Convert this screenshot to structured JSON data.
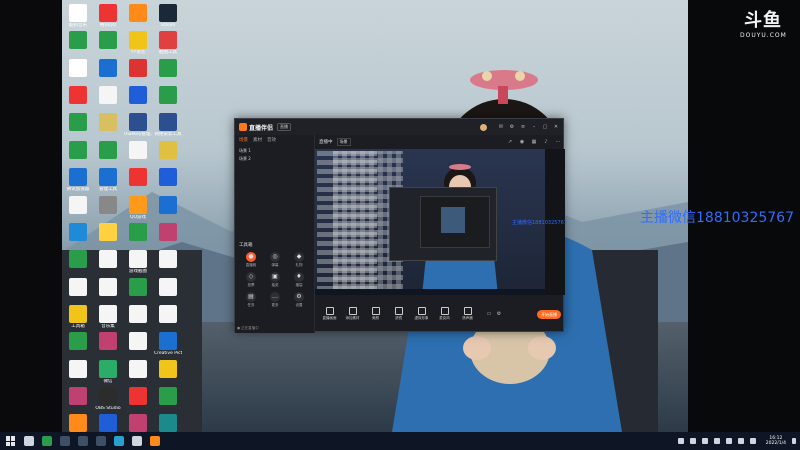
{
  "watermark": {
    "contact": "主播微信18810325767",
    "small_text": "主播微信18810325767"
  },
  "brand": {
    "logo_big": "斗鱼",
    "logo_small": "DOUYU.COM"
  },
  "desktop_icons": [
    {
      "label": "酷狗音乐",
      "color": "#ffffff"
    },
    {
      "label": "腾讯QQ",
      "color": "#e33"
    },
    {
      "label": "",
      "color": "#ff8a1a"
    },
    {
      "label": "Steam",
      "color": "#1b2838"
    },
    {
      "label": "",
      "color": "#2a9d4a"
    },
    {
      "label": "",
      "color": "#2a9d4a"
    },
    {
      "label": "YY语音",
      "color": "#f0c419"
    },
    {
      "label": "截图工具",
      "color": "#e04040"
    },
    {
      "label": "",
      "color": "#fff"
    },
    {
      "label": "",
      "color": "#1a6fd1"
    },
    {
      "label": "",
      "color": "#d33"
    },
    {
      "label": "",
      "color": "#2a9d4a"
    },
    {
      "label": "",
      "color": "#e33"
    },
    {
      "label": "",
      "color": "#f5f5f5"
    },
    {
      "label": "",
      "color": "#1f5ed8"
    },
    {
      "label": "",
      "color": "#2a9d4a"
    },
    {
      "label": "",
      "color": "#2a9d4a"
    },
    {
      "label": "",
      "color": "#d8c060"
    },
    {
      "label": "USBKey管理工具",
      "color": "#2b4f8f"
    },
    {
      "label": "网络安装工具",
      "color": "#2b4f8f"
    },
    {
      "label": "",
      "color": "#2a9d4a"
    },
    {
      "label": "",
      "color": "#2a9d4a"
    },
    {
      "label": "",
      "color": "#f5f5f5"
    },
    {
      "label": "",
      "color": "#e0c040"
    },
    {
      "label": "腾讯加速器",
      "color": "#1a6fd1"
    },
    {
      "label": "管理工具",
      "color": "#1a6fd1"
    },
    {
      "label": "",
      "color": "#e33"
    },
    {
      "label": "",
      "color": "#1f5ed8"
    },
    {
      "label": "",
      "color": "#f5f5f5"
    },
    {
      "label": "",
      "color": "#888"
    },
    {
      "label": "QQ游戏",
      "color": "#ff9a1a"
    },
    {
      "label": "",
      "color": "#1a6fd1"
    },
    {
      "label": "",
      "color": "#1f8ad8"
    },
    {
      "label": "",
      "color": "#ffd040"
    },
    {
      "label": "",
      "color": "#2a9d4a"
    },
    {
      "label": "",
      "color": "#c04070"
    },
    {
      "label": "",
      "color": "#2a9d4a"
    },
    {
      "label": "",
      "color": "#f5f5f5"
    },
    {
      "label": "游戏截图",
      "color": "#f5f5f5"
    },
    {
      "label": "",
      "color": "#f5f5f5"
    },
    {
      "label": "",
      "color": "#f5f5f5"
    },
    {
      "label": "",
      "color": "#f5f5f5"
    },
    {
      "label": "",
      "color": "#2a9d4a"
    },
    {
      "label": "",
      "color": "#f5f5f5"
    },
    {
      "label": "工具箱",
      "color": "#f0c419"
    },
    {
      "label": "音乐集",
      "color": "#f5f5f5"
    },
    {
      "label": "",
      "color": "#f5f5f5"
    },
    {
      "label": "",
      "color": "#f5f5f5"
    },
    {
      "label": "",
      "color": "#2a9d4a"
    },
    {
      "label": "",
      "color": "#c04070"
    },
    {
      "label": "",
      "color": "#f5f5f5"
    },
    {
      "label": "Creative Pictures",
      "color": "#1a6fd1"
    },
    {
      "label": "",
      "color": "#f5f5f5"
    },
    {
      "label": "微信",
      "color": "#2aae67"
    },
    {
      "label": "",
      "color": "#f5f5f5"
    },
    {
      "label": "",
      "color": "#f0c419"
    },
    {
      "label": "",
      "color": "#c04070"
    },
    {
      "label": "OBS Studio",
      "color": "#2c2c2c"
    },
    {
      "label": "",
      "color": "#e33"
    },
    {
      "label": "",
      "color": "#2a9d4a"
    },
    {
      "label": "",
      "color": "#ff8a1a"
    },
    {
      "label": "",
      "color": "#1f5ed8"
    },
    {
      "label": "",
      "color": "#c04070"
    },
    {
      "label": "",
      "color": "#1a8a8a"
    }
  ],
  "app": {
    "name": "直播伴侣",
    "version": "直播",
    "preview_title": "直播中",
    "preview_badge": "场景",
    "scene_tabs": [
      {
        "label": "场景",
        "active": true
      },
      {
        "label": "素材",
        "active": false
      },
      {
        "label": "音效",
        "active": false
      }
    ],
    "scene_rows": [
      "场景 1",
      "场景 2"
    ],
    "tools_title": "工具箱",
    "tools": [
      {
        "label": "直播姬",
        "hot": true,
        "glyph": "●"
      },
      {
        "label": "弹幕",
        "hot": false,
        "glyph": "◎"
      },
      {
        "label": "礼物",
        "hot": false,
        "glyph": "◆"
      },
      {
        "label": "投票",
        "hot": false,
        "glyph": "◇"
      },
      {
        "label": "抽奖",
        "hot": false,
        "glyph": "▣"
      },
      {
        "label": "福袋",
        "hot": false,
        "glyph": "♦"
      },
      {
        "label": "任务",
        "hot": false,
        "glyph": "▤"
      },
      {
        "label": "更多",
        "hot": false,
        "glyph": "…"
      },
      {
        "label": "设置",
        "hot": false,
        "glyph": "⚙"
      }
    ],
    "status": "● 正在直播中",
    "bottom_buttons": [
      "直播画面",
      "添加素材",
      "美颜",
      "滤镜",
      "虚拟形象",
      "麦克风",
      "扬声器"
    ],
    "live_button": "开始直播"
  },
  "taskbar": {
    "time": "16:12",
    "date": "2022/1/4"
  }
}
